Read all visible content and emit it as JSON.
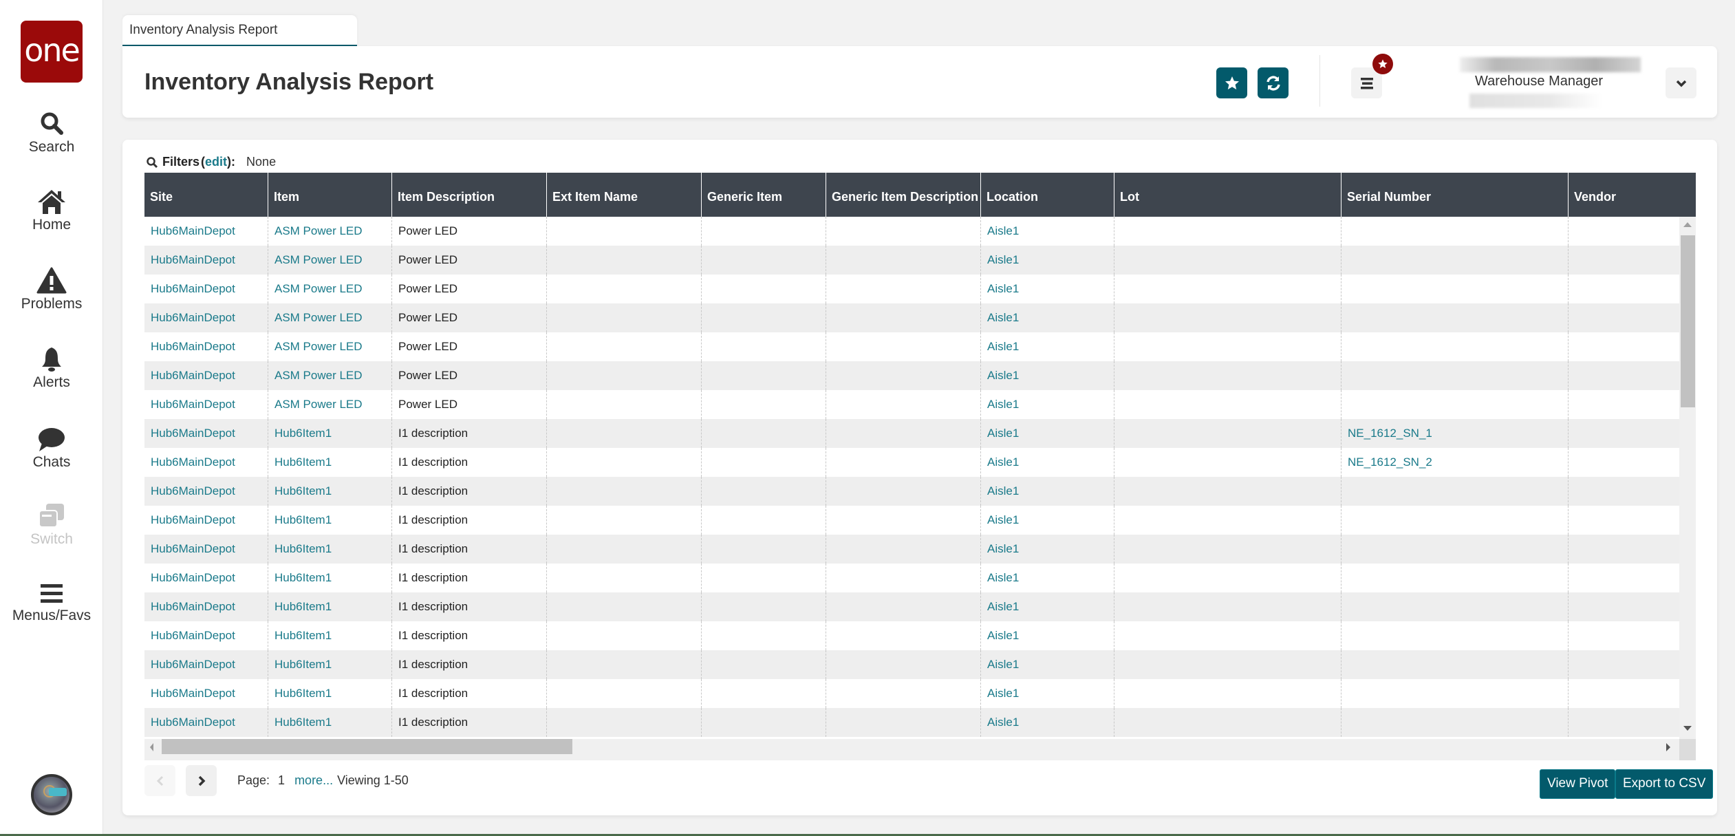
{
  "sidebar": {
    "logo_text": "one",
    "items": [
      {
        "label": "Search",
        "icon": "search-icon"
      },
      {
        "label": "Home",
        "icon": "home-icon"
      },
      {
        "label": "Problems",
        "icon": "warning-icon"
      },
      {
        "label": "Alerts",
        "icon": "bell-icon"
      },
      {
        "label": "Chats",
        "icon": "chat-icon"
      },
      {
        "label": "Switch",
        "icon": "switch-icon",
        "disabled": true
      },
      {
        "label": "Menus/Favs",
        "icon": "menu-icon"
      }
    ],
    "avatar": "ai-assistant-avatar"
  },
  "tab": {
    "label": "Inventory Analysis Report"
  },
  "header": {
    "title": "Inventory Analysis Report",
    "buttons": [
      "favorite-star",
      "refresh"
    ],
    "menu_badge": "star",
    "user_role": "Warehouse Manager"
  },
  "filters": {
    "label": "Filters",
    "edit": "edit",
    "open_paren": "(",
    "close": "):",
    "value": "None"
  },
  "grid": {
    "columns": [
      "Site",
      "Item",
      "Item Description",
      "Ext Item Name",
      "Generic Item",
      "Generic Item Description",
      "Location",
      "Lot",
      "Serial Number",
      "Vendor"
    ],
    "rows": [
      [
        "Hub6MainDepot",
        "ASM Power LED",
        "Power LED",
        "",
        "",
        "",
        "Aisle1",
        "",
        "",
        ""
      ],
      [
        "Hub6MainDepot",
        "ASM Power LED",
        "Power LED",
        "",
        "",
        "",
        "Aisle1",
        "",
        "",
        ""
      ],
      [
        "Hub6MainDepot",
        "ASM Power LED",
        "Power LED",
        "",
        "",
        "",
        "Aisle1",
        "",
        "",
        ""
      ],
      [
        "Hub6MainDepot",
        "ASM Power LED",
        "Power LED",
        "",
        "",
        "",
        "Aisle1",
        "",
        "",
        ""
      ],
      [
        "Hub6MainDepot",
        "ASM Power LED",
        "Power LED",
        "",
        "",
        "",
        "Aisle1",
        "",
        "",
        ""
      ],
      [
        "Hub6MainDepot",
        "ASM Power LED",
        "Power LED",
        "",
        "",
        "",
        "Aisle1",
        "",
        "",
        ""
      ],
      [
        "Hub6MainDepot",
        "ASM Power LED",
        "Power LED",
        "",
        "",
        "",
        "Aisle1",
        "",
        "",
        ""
      ],
      [
        "Hub6MainDepot",
        "Hub6Item1",
        "I1 description",
        "",
        "",
        "",
        "Aisle1",
        "",
        "NE_1612_SN_1",
        ""
      ],
      [
        "Hub6MainDepot",
        "Hub6Item1",
        "I1 description",
        "",
        "",
        "",
        "Aisle1",
        "",
        "NE_1612_SN_2",
        ""
      ],
      [
        "Hub6MainDepot",
        "Hub6Item1",
        "I1 description",
        "",
        "",
        "",
        "Aisle1",
        "",
        "",
        ""
      ],
      [
        "Hub6MainDepot",
        "Hub6Item1",
        "I1 description",
        "",
        "",
        "",
        "Aisle1",
        "",
        "",
        ""
      ],
      [
        "Hub6MainDepot",
        "Hub6Item1",
        "I1 description",
        "",
        "",
        "",
        "Aisle1",
        "",
        "",
        ""
      ],
      [
        "Hub6MainDepot",
        "Hub6Item1",
        "I1 description",
        "",
        "",
        "",
        "Aisle1",
        "",
        "",
        ""
      ],
      [
        "Hub6MainDepot",
        "Hub6Item1",
        "I1 description",
        "",
        "",
        "",
        "Aisle1",
        "",
        "",
        ""
      ],
      [
        "Hub6MainDepot",
        "Hub6Item1",
        "I1 description",
        "",
        "",
        "",
        "Aisle1",
        "",
        "",
        ""
      ],
      [
        "Hub6MainDepot",
        "Hub6Item1",
        "I1 description",
        "",
        "",
        "",
        "Aisle1",
        "",
        "",
        ""
      ],
      [
        "Hub6MainDepot",
        "Hub6Item1",
        "I1 description",
        "",
        "",
        "",
        "Aisle1",
        "",
        "",
        ""
      ],
      [
        "Hub6MainDepot",
        "Hub6Item1",
        "I1 description",
        "",
        "",
        "",
        "Aisle1",
        "",
        "",
        ""
      ]
    ],
    "link_columns": [
      0,
      1,
      6,
      8
    ]
  },
  "pager": {
    "page_label": "Page:",
    "page": "1",
    "more": "more...",
    "viewing": "Viewing 1-50"
  },
  "actions": {
    "view_pivot": "View Pivot",
    "export_csv": "Export to CSV"
  },
  "colors": {
    "brand": "#9b0a0a",
    "accent": "#035a6b",
    "link": "#1a7a8a",
    "grid_header": "#3e454e"
  }
}
